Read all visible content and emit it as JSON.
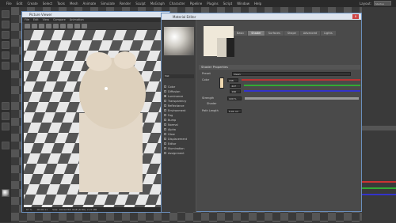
{
  "menubar": {
    "items": [
      "File",
      "Edit",
      "Create",
      "Select",
      "Tools",
      "Mesh",
      "Animate",
      "Simulate",
      "Render",
      "Sculpt",
      "MoGraph",
      "Character",
      "Pipeline",
      "Plugins",
      "Script",
      "Window",
      "Help"
    ],
    "layout_label": "Layout:",
    "layout_value": "Startup (User)"
  },
  "picture_viewer": {
    "title": "Picture Viewer",
    "menu": [
      "File",
      "Edit",
      "View",
      "Compare",
      "Animation"
    ],
    "status_zoom": "67 %",
    "status_time": "00:00:11",
    "status_size": "Size: 1024x768, RGB (8 Bit), 2.27 MB"
  },
  "material_editor": {
    "title": "Material Editor",
    "close_label": "x",
    "material_name": "Mat",
    "tabs": [
      "Basic",
      "Shader",
      "Surfaces",
      "Shape",
      "Advanced",
      "Lights"
    ],
    "active_tab": "Shader",
    "channels": [
      {
        "label": "Color",
        "on": false
      },
      {
        "label": "Diffusion",
        "on": false
      },
      {
        "label": "Luminance",
        "on": true
      },
      {
        "label": "Transparency",
        "on": false
      },
      {
        "label": "Reflectance",
        "on": false
      },
      {
        "label": "Environment",
        "on": false
      },
      {
        "label": "Fog",
        "on": false
      },
      {
        "label": "Bump",
        "on": false
      },
      {
        "label": "Normal",
        "on": false
      },
      {
        "label": "Alpha",
        "on": false
      },
      {
        "label": "Glow",
        "on": false
      },
      {
        "label": "Displacement",
        "on": false
      },
      {
        "label": "Editor",
        "on": false
      },
      {
        "label": "Illumination",
        "on": false
      },
      {
        "label": "Assignment",
        "on": false
      }
    ],
    "shader_properties": "Shader Properties",
    "preset_label": "Preset",
    "preset_value": "Clean",
    "color_label": "Color",
    "r_value": "246",
    "g_value": "227",
    "b_value": "196",
    "strength_label": "Strength",
    "strength_value": "100 %",
    "shader_label": "Shader",
    "pathlength_label": "Path Length",
    "pathlength_value": "5.01 cm"
  },
  "colors": {
    "accent": "#6a8fbd",
    "title_bg": "#dde4ee",
    "swatch": "#f0d9b0"
  }
}
